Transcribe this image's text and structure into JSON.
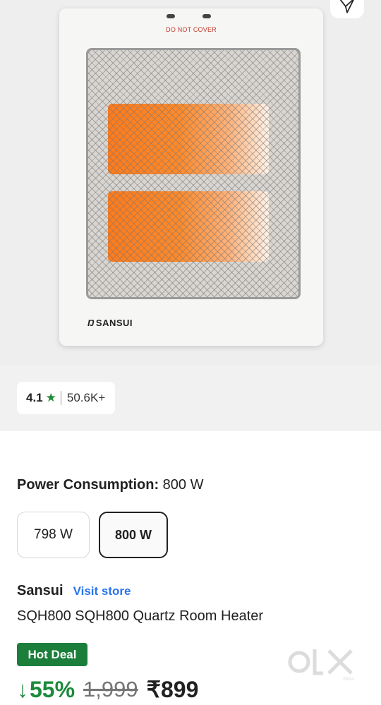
{
  "product_image": {
    "label": "DO NOT COVER",
    "brand_logo": "SANSUI",
    "brand_mark": "Ŋ"
  },
  "share_icon": "send-icon",
  "rating": {
    "value": "4.1",
    "star": "★",
    "count": "50.6K+"
  },
  "power": {
    "label": "Power Consumption:",
    "value": "800 W",
    "options": [
      "798 W",
      "800 W"
    ]
  },
  "seller": {
    "name": "Sansui",
    "visit_store": "Visit store"
  },
  "product_title": "SQH800 SQH800 Quartz Room Heater",
  "deal_badge": "Hot Deal",
  "pricing": {
    "arrow": "↓",
    "discount": "55%",
    "mrp": "1,999",
    "price": "₹899"
  },
  "watermark": {
    "brand": "olx",
    "region": "INDIA"
  },
  "colors": {
    "accent_green": "#1b8a3c",
    "link_blue": "#2874f0",
    "star_green": "#1e8c3a"
  }
}
